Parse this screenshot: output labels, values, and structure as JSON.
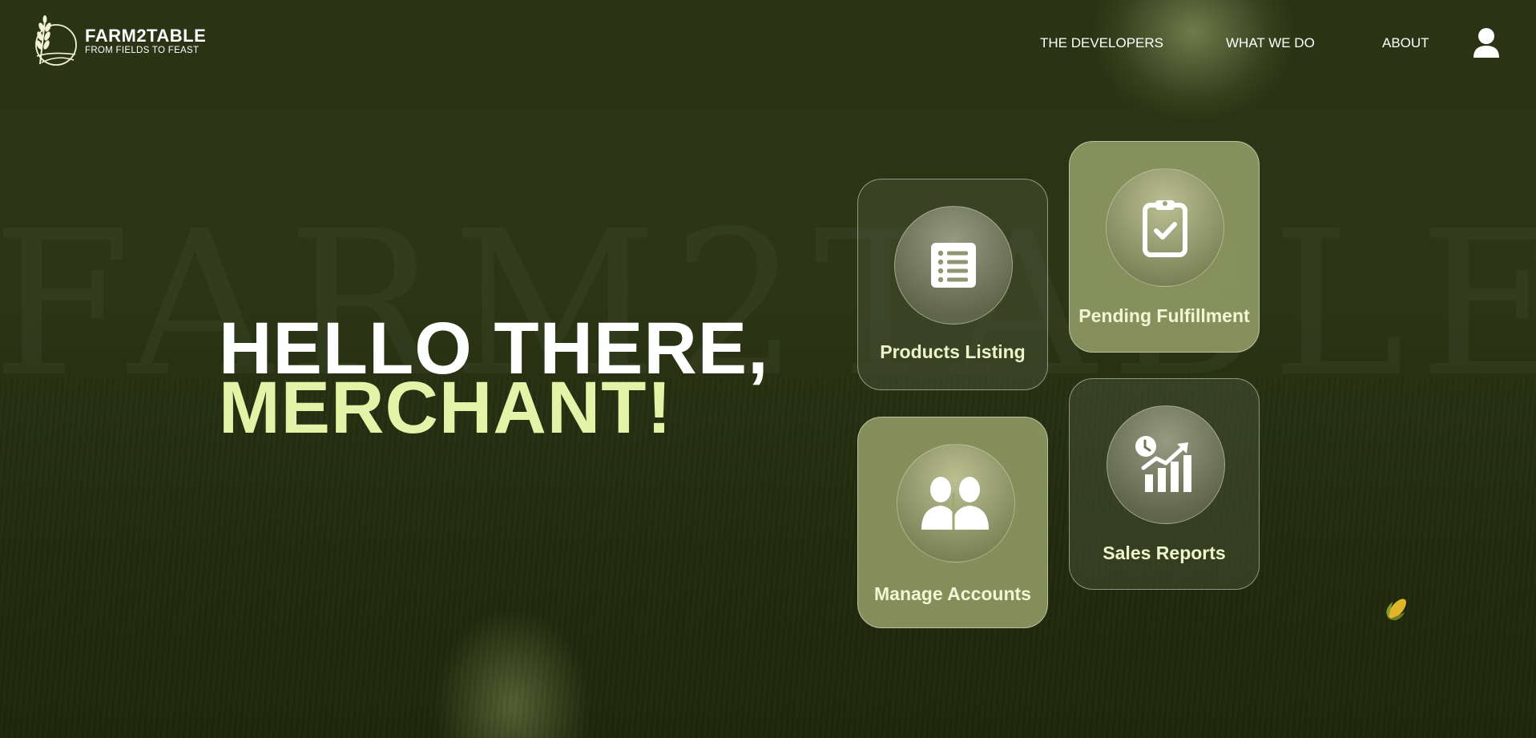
{
  "brand": {
    "name": "FARM2TABLE",
    "tagline": "FROM FIELDS TO FEAST",
    "watermark": "FARM2TABLE"
  },
  "nav": {
    "items": [
      {
        "label": "THE DEVELOPERS"
      },
      {
        "label": "WHAT WE DO"
      },
      {
        "label": "ABOUT"
      }
    ],
    "user_icon": "user-icon"
  },
  "hero": {
    "greeting": "HELLO THERE,",
    "role": "MERCHANT!"
  },
  "cards": [
    {
      "label": "Products Listing",
      "icon": "list-icon"
    },
    {
      "label": "Pending Fulfillment",
      "icon": "clipboard-check-icon"
    },
    {
      "label": "Manage Accounts",
      "icon": "users-icon"
    },
    {
      "label": "Sales Reports",
      "icon": "sales-chart-icon"
    }
  ],
  "colors": {
    "background": "#2a3313",
    "accent": "#e4f3a8",
    "card_light": "#96a069",
    "card_dark": "#464e32"
  },
  "decor": {
    "corner_icon": "corn-icon"
  }
}
